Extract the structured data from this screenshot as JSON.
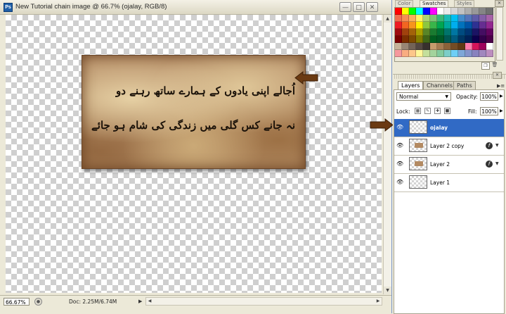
{
  "document": {
    "title": "New Tutorial chain image @ 66.7% (ojalay, RGB/8)",
    "zoom": "66.67%",
    "doc_size": "Doc: 2.25M/6.74M"
  },
  "artwork": {
    "line1": "اُجالے اپنی یادوں کے ہمارے ساتھ رہنے دو",
    "line2": "نہ جانے کس گلی میں زندگی کی شام ہو جائے"
  },
  "swatches_panel": {
    "tabs": [
      "Color",
      "Swatches",
      "Styles"
    ],
    "colors": [
      "#ff0000",
      "#ffff00",
      "#00ff00",
      "#00ffff",
      "#0000ff",
      "#ff00ff",
      "#ffffff",
      "#ebebeb",
      "#d6d6d6",
      "#c2c2c2",
      "#adadad",
      "#999999",
      "#858585",
      "#707070",
      "#f26c4f",
      "#f68e55",
      "#fbaf5c",
      "#fff467",
      "#acd372",
      "#7cc576",
      "#3bb878",
      "#1abbb4",
      "#00bff3",
      "#438ccb",
      "#5574b9",
      "#605ca8",
      "#855fa8",
      "#a763a8",
      "#ed1c24",
      "#f26522",
      "#f7941d",
      "#fff200",
      "#8dc73f",
      "#39b54a",
      "#00a651",
      "#00a99d",
      "#00aeef",
      "#0072bc",
      "#0054a6",
      "#2e3192",
      "#662d91",
      "#92278f",
      "#9e0b0f",
      "#a0410d",
      "#a36209",
      "#aba000",
      "#598527",
      "#1a7b30",
      "#007236",
      "#00746b",
      "#0076a3",
      "#004b80",
      "#003471",
      "#1b1464",
      "#440e62",
      "#630460",
      "#790000",
      "#7b2e00",
      "#7d4900",
      "#827b00",
      "#406618",
      "#005e20",
      "#005826",
      "#005952",
      "#005b7f",
      "#003663",
      "#002157",
      "#0d004c",
      "#32004b",
      "#4b0049",
      "#c7b299",
      "#998675",
      "#736357",
      "#534741",
      "#37302d",
      "#c69c6d",
      "#a67c52",
      "#8c6239",
      "#754c24",
      "#603913",
      "#ff7bac",
      "#d4145a",
      "#9e005d",
      "#ffffff",
      "#f5989d",
      "#f9ad81",
      "#fdc68a",
      "#fff799",
      "#c4df9b",
      "#a3d39c",
      "#82ca9d",
      "#7bcdc8",
      "#6ecff6",
      "#7ea7d8",
      "#8493ca",
      "#8882be",
      "#a187be",
      "#bc8dbf"
    ]
  },
  "layers_panel": {
    "tabs": [
      "Layers",
      "Channels",
      "Paths"
    ],
    "blend_mode": "Normal",
    "opacity_label": "Opacity:",
    "opacity_value": "100%",
    "lock_label": "Lock:",
    "fill_label": "Fill:",
    "fill_value": "100%",
    "layers": [
      {
        "name": "ojalay",
        "selected": true,
        "has_fx": false,
        "thumb": "empty"
      },
      {
        "name": "Layer 2 copy",
        "selected": false,
        "has_fx": true,
        "thumb": "parchment"
      },
      {
        "name": "Layer 2",
        "selected": false,
        "has_fx": true,
        "thumb": "parchment"
      },
      {
        "name": "Layer 1",
        "selected": false,
        "has_fx": false,
        "thumb": "empty"
      }
    ]
  },
  "colors": {
    "selection": "#316ac5",
    "arrow": "#6b3a12"
  }
}
